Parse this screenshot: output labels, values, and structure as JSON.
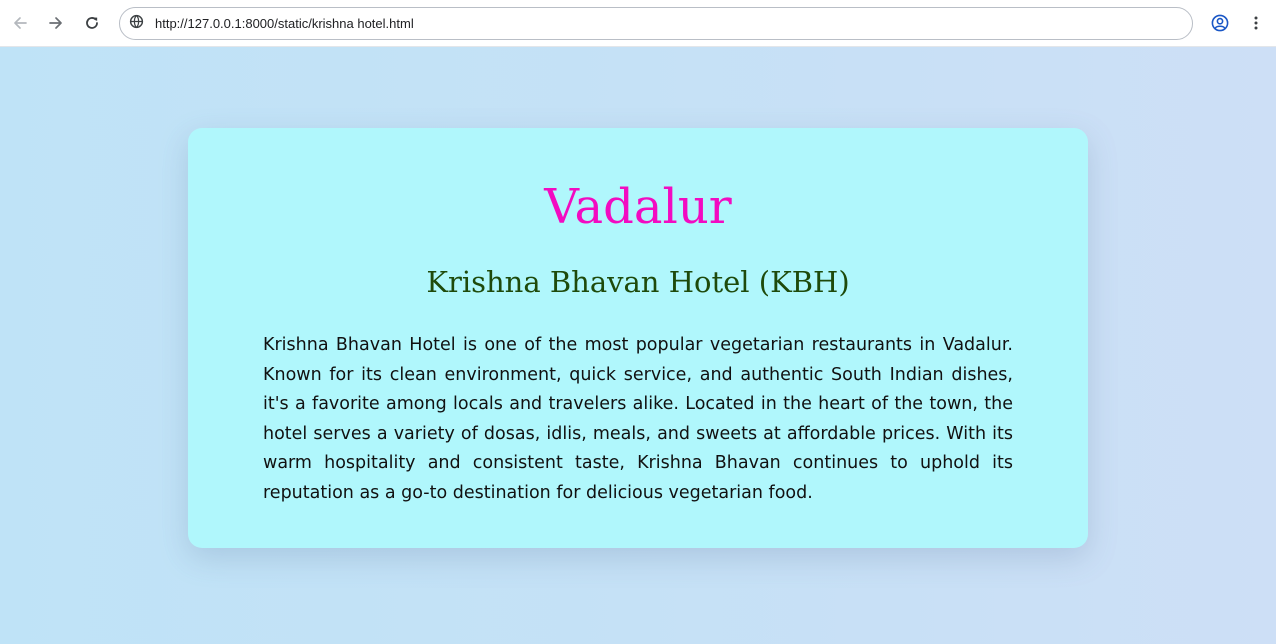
{
  "browser": {
    "url": "http://127.0.0.1:8000/static/krishna hotel.html",
    "icons": {
      "back": "arrow-left-icon",
      "forward": "arrow-right-icon",
      "reload": "reload-icon",
      "site_info": "globe-icon",
      "profile": "account-circle-icon",
      "menu": "vertical-dots-icon"
    }
  },
  "page": {
    "city": "Vadalur",
    "hotel_name": "Krishna Bhavan Hotel (KBH)",
    "description": "Krishna Bhavan Hotel is one of the most popular vegetarian restaurants in Vadalur. Known for its clean environment, quick service, and authentic South Indian dishes, it's a favorite among locals and travelers alike. Located in the heart of the town, the hotel serves a variety of dosas, idlis, meals, and sweets at affordable prices. With its warm hospitality and consistent taste, Krishna Bhavan continues to uphold its reputation as a go-to destination for delicious vegetarian food."
  },
  "colors": {
    "city_title": "#f20bc1",
    "hotel_name": "#1e4a0b",
    "card_background": "#b0f7fc",
    "page_background": "#c5e1f6"
  }
}
